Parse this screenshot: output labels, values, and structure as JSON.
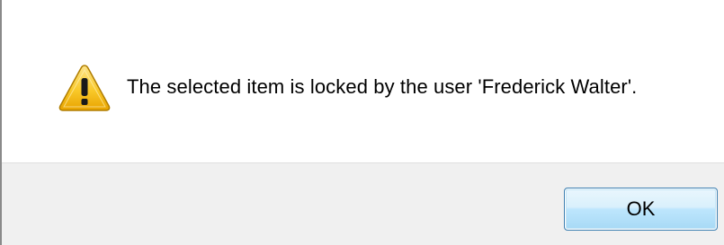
{
  "dialog": {
    "message": "The selected item is locked by the user 'Frederick Walter'.",
    "icon": "warning-icon",
    "ok_label": "OK"
  },
  "colors": {
    "warning_fill": "#f9c92a",
    "button_border": "#3c7fb1",
    "button_bar_bg": "#f0f0f0"
  }
}
